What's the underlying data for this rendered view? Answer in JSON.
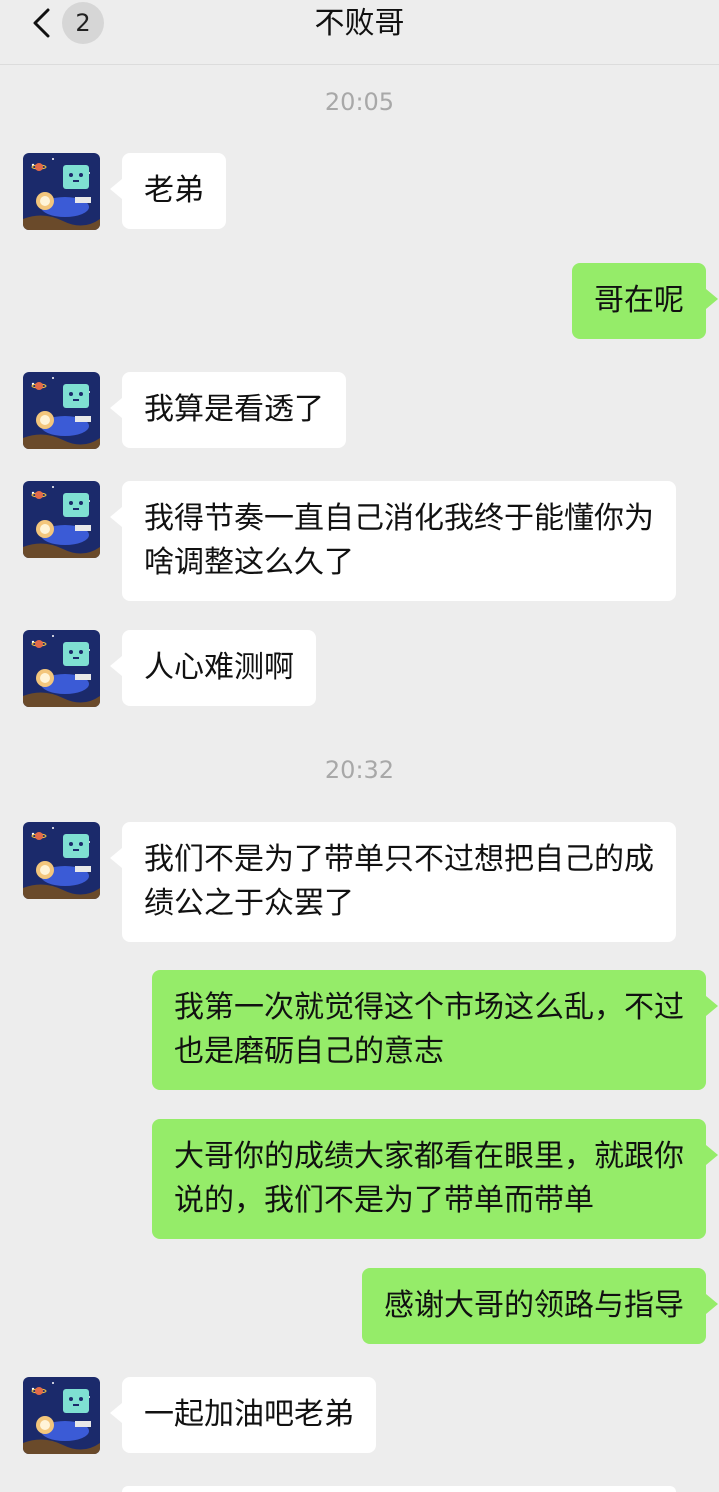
{
  "header": {
    "title": "不败哥",
    "unread_count": "2"
  },
  "timestamps": [
    "20:05",
    "20:32"
  ],
  "messages": [
    {
      "from": "contact",
      "text": "老弟"
    },
    {
      "from": "me",
      "text": "哥在呢"
    },
    {
      "from": "contact",
      "text": "我算是看透了"
    },
    {
      "from": "contact",
      "text": "我得节奏一直自己消化我终于能懂你为啥调整这么久了"
    },
    {
      "from": "contact",
      "text": "人心难测啊"
    },
    {
      "from": "contact",
      "text": "我们不是为了带单只不过想把自己的成绩公之于众罢了"
    },
    {
      "from": "me",
      "text": "我第一次就觉得这个市场这么乱，不过也是磨砺自己的意志"
    },
    {
      "from": "me",
      "text": "大哥你的成绩大家都看在眼里，就跟你说的，我们不是为了带单而带单"
    },
    {
      "from": "me",
      "text": "感谢大哥的领路与指导"
    },
    {
      "from": "contact",
      "text": "一起加油吧老弟"
    }
  ],
  "colors": {
    "background": "#ededed",
    "incoming_bubble": "#ffffff",
    "outgoing_bubble": "#95ec69",
    "timestamp_text": "#a8a8a8"
  },
  "icons": [
    "back-chevron-icon",
    "contact-avatar"
  ]
}
